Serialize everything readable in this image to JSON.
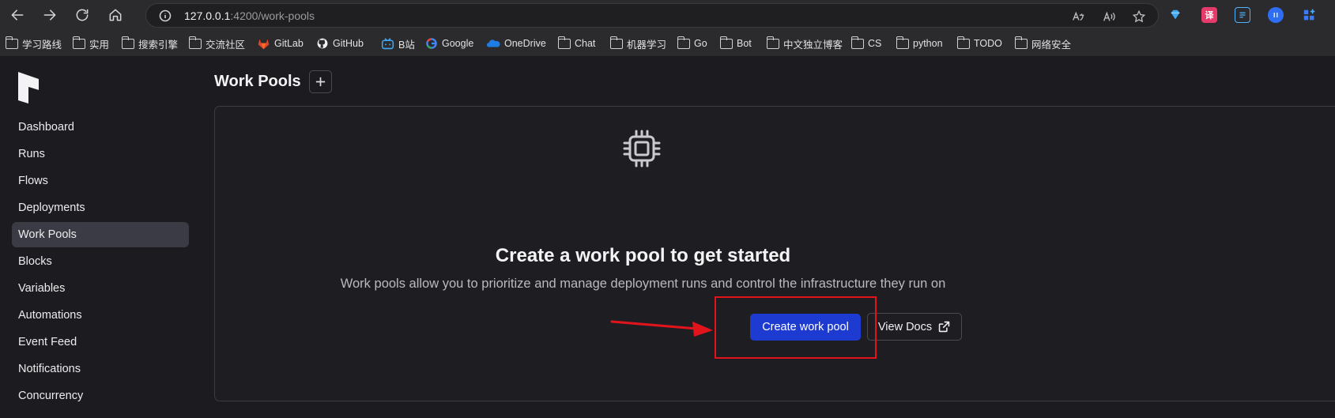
{
  "browser": {
    "url_host": "127.0.0.1",
    "url_rest": ":4200/work-pools",
    "nav": [
      "back-icon",
      "forward-icon",
      "reload-icon",
      "home-icon"
    ],
    "bookmarks": [
      {
        "label": "学习路线",
        "icon": "folder-icon"
      },
      {
        "label": "实用",
        "icon": "folder-icon"
      },
      {
        "label": "搜索引擎",
        "icon": "folder-icon"
      },
      {
        "label": "交流社区",
        "icon": "folder-icon"
      },
      {
        "label": "GitLab",
        "icon": "gitlab-icon"
      },
      {
        "label": "GitHub",
        "icon": "github-icon"
      },
      {
        "label": "B站",
        "icon": "bilibili-icon"
      },
      {
        "label": "Google",
        "icon": "google-icon"
      },
      {
        "label": "OneDrive",
        "icon": "onedrive-icon"
      },
      {
        "label": "Chat",
        "icon": "folder-icon"
      },
      {
        "label": "机器学习",
        "icon": "folder-icon"
      },
      {
        "label": "Go",
        "icon": "folder-icon"
      },
      {
        "label": "Bot",
        "icon": "folder-icon"
      },
      {
        "label": "中文独立博客",
        "icon": "folder-icon"
      },
      {
        "label": "CS",
        "icon": "folder-icon"
      },
      {
        "label": "python",
        "icon": "folder-icon"
      },
      {
        "label": "TODO",
        "icon": "folder-icon"
      },
      {
        "label": "网络安全",
        "icon": "folder-icon"
      }
    ]
  },
  "sidebar": {
    "items": [
      {
        "label": "Dashboard",
        "active": false
      },
      {
        "label": "Runs",
        "active": false
      },
      {
        "label": "Flows",
        "active": false
      },
      {
        "label": "Deployments",
        "active": false
      },
      {
        "label": "Work Pools",
        "active": true
      },
      {
        "label": "Blocks",
        "active": false
      },
      {
        "label": "Variables",
        "active": false
      },
      {
        "label": "Automations",
        "active": false
      },
      {
        "label": "Event Feed",
        "active": false
      },
      {
        "label": "Notifications",
        "active": false
      },
      {
        "label": "Concurrency",
        "active": false
      }
    ]
  },
  "header": {
    "title": "Work Pools"
  },
  "empty_state": {
    "icon": "cpu-chip-icon",
    "title": "Create a work pool to get started",
    "subtitle": "Work pools allow you to prioritize and manage deployment runs and control the infrastructure they run on",
    "primary_button": "Create work pool",
    "secondary_button": "View Docs"
  },
  "colors": {
    "accent": "#1e3bd1",
    "annotation": "#e2141b",
    "active_nav": "#3a3b45"
  }
}
